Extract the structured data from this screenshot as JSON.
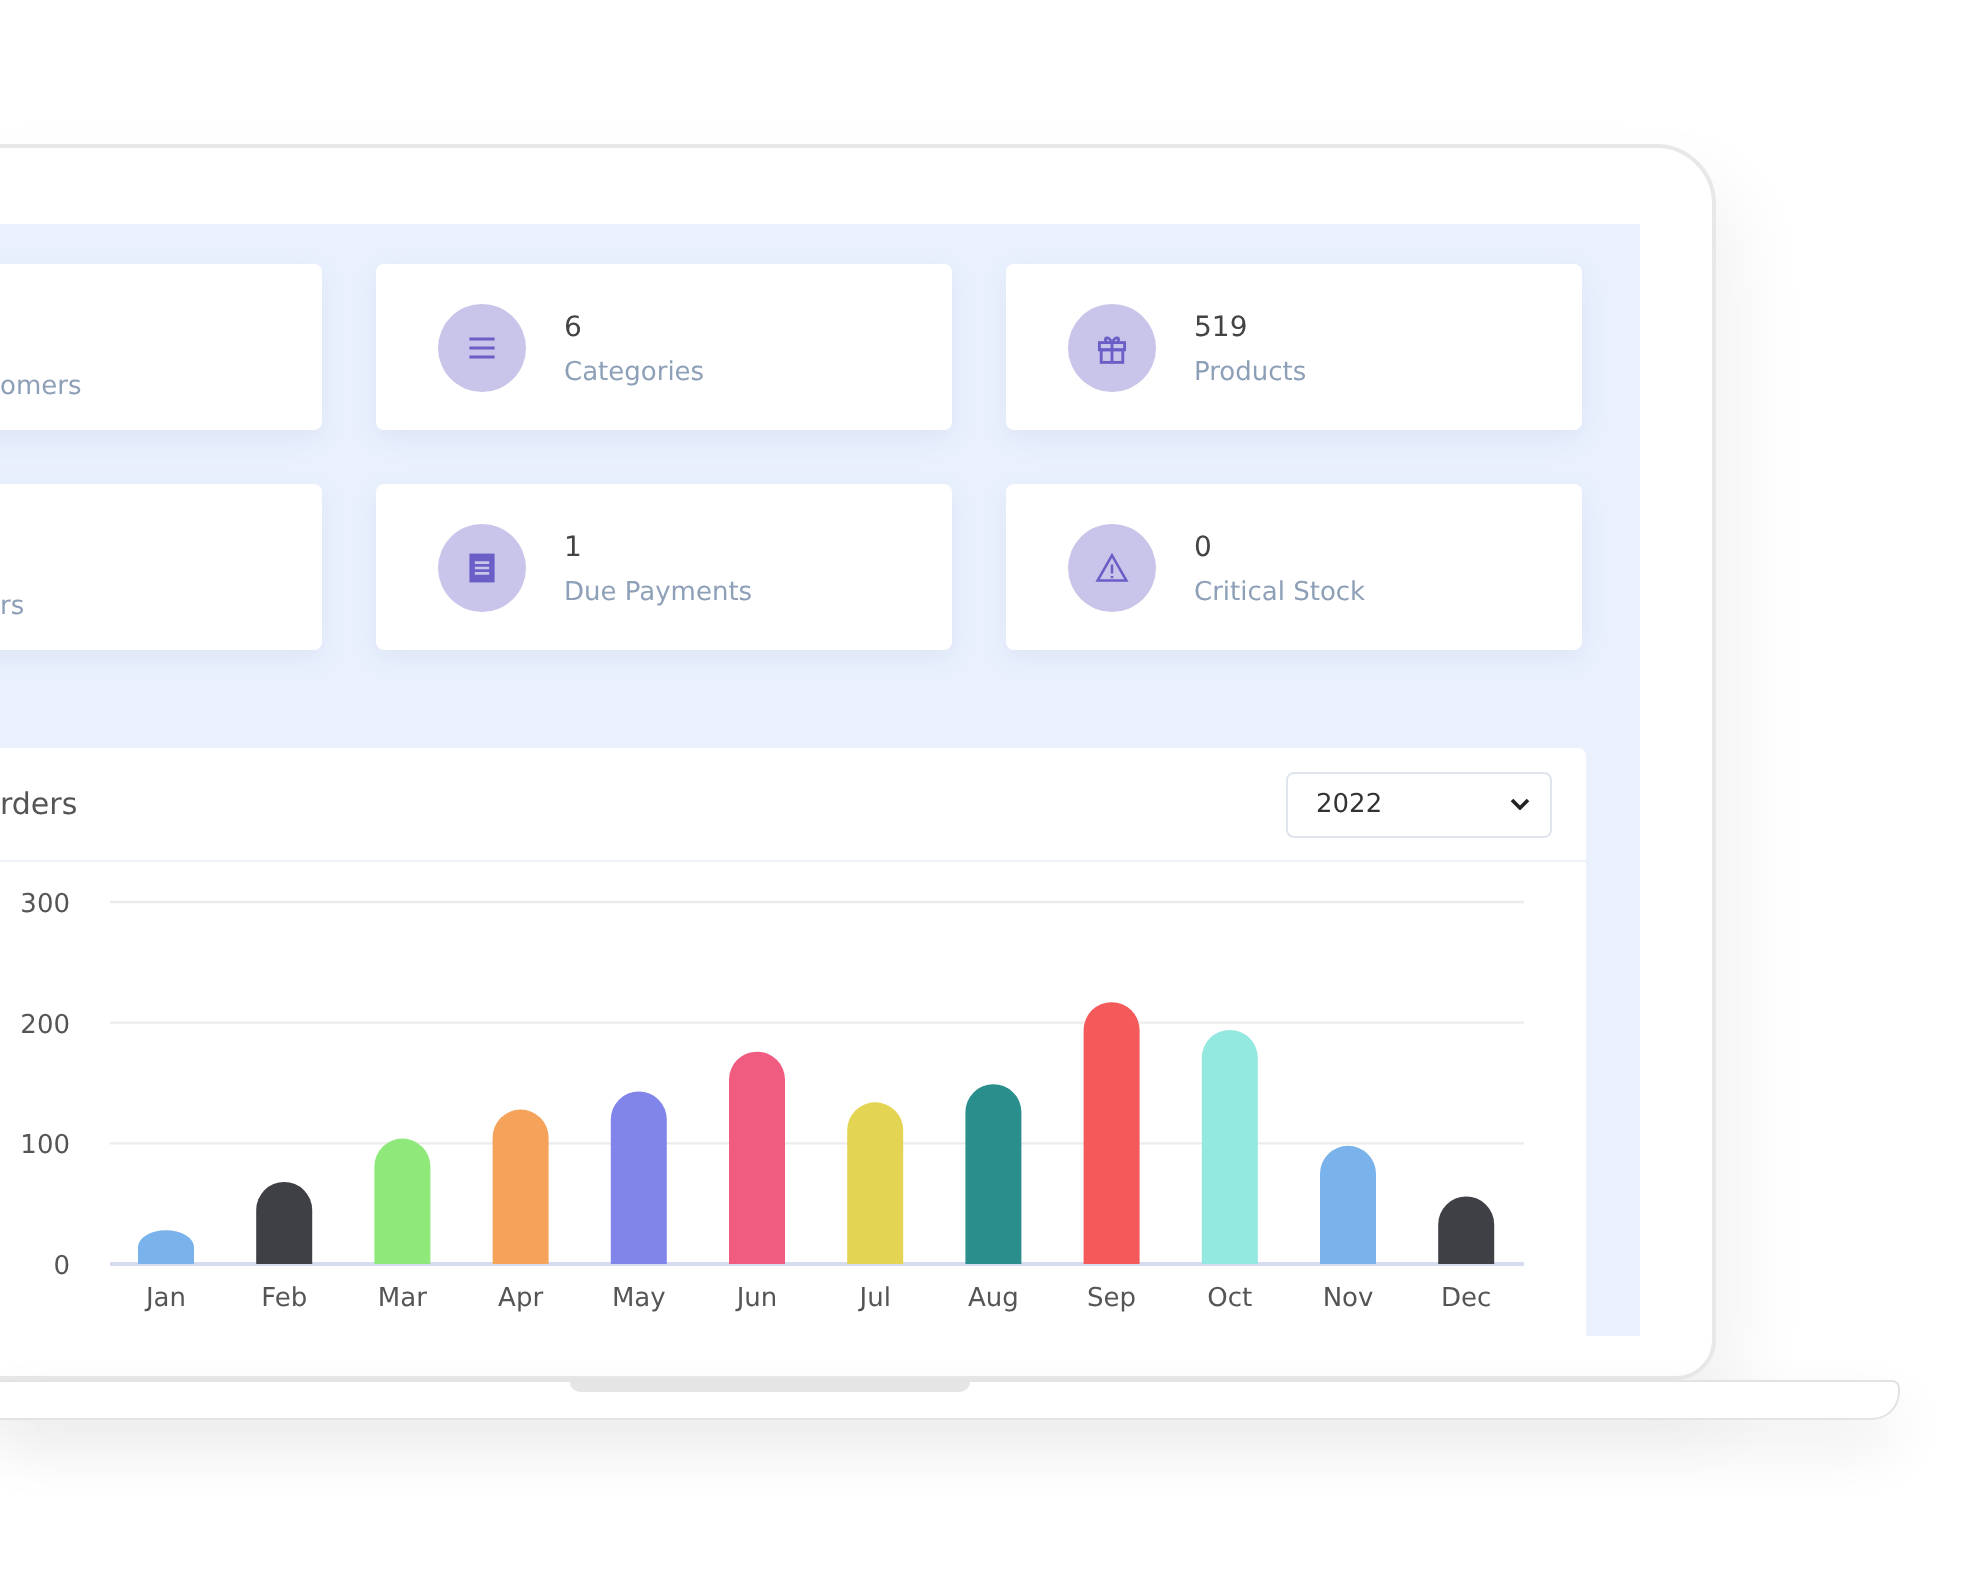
{
  "cards": [
    {
      "kind": "clipped",
      "label": "omers"
    },
    {
      "kind": "stat",
      "value": "6",
      "label": "Categories"
    },
    {
      "kind": "stat",
      "value": "519",
      "label": "Products"
    },
    {
      "kind": "clipped",
      "label": "rs"
    },
    {
      "kind": "stat",
      "value": "1",
      "label": "Due Payments"
    },
    {
      "kind": "stat",
      "value": "0",
      "label": "Critical Stock"
    }
  ],
  "orders_panel": {
    "title": "rders",
    "year_select": {
      "value": "2022"
    },
    "chart_data": {
      "type": "bar",
      "categories": [
        "Jan",
        "Feb",
        "Mar",
        "Apr",
        "May",
        "Jun",
        "Jul",
        "Aug",
        "Sep",
        "Oct",
        "Nov",
        "Dec"
      ],
      "ylim": [
        0,
        300
      ],
      "yticks": [
        0,
        100,
        200,
        300
      ],
      "series": [
        {
          "colors": [
            "#7ab3ec",
            "#3f3f46",
            "#8fe97a",
            "#f5a25a",
            "#8184e8",
            "#f05c80",
            "#e4d453",
            "#2a8f8c",
            "#f55a5a",
            "#93e8df",
            "#7ab3ec",
            "#3f3f46"
          ],
          "values": [
            28,
            68,
            104,
            128,
            143,
            176,
            134,
            149,
            217,
            194,
            98,
            56
          ]
        }
      ]
    }
  }
}
